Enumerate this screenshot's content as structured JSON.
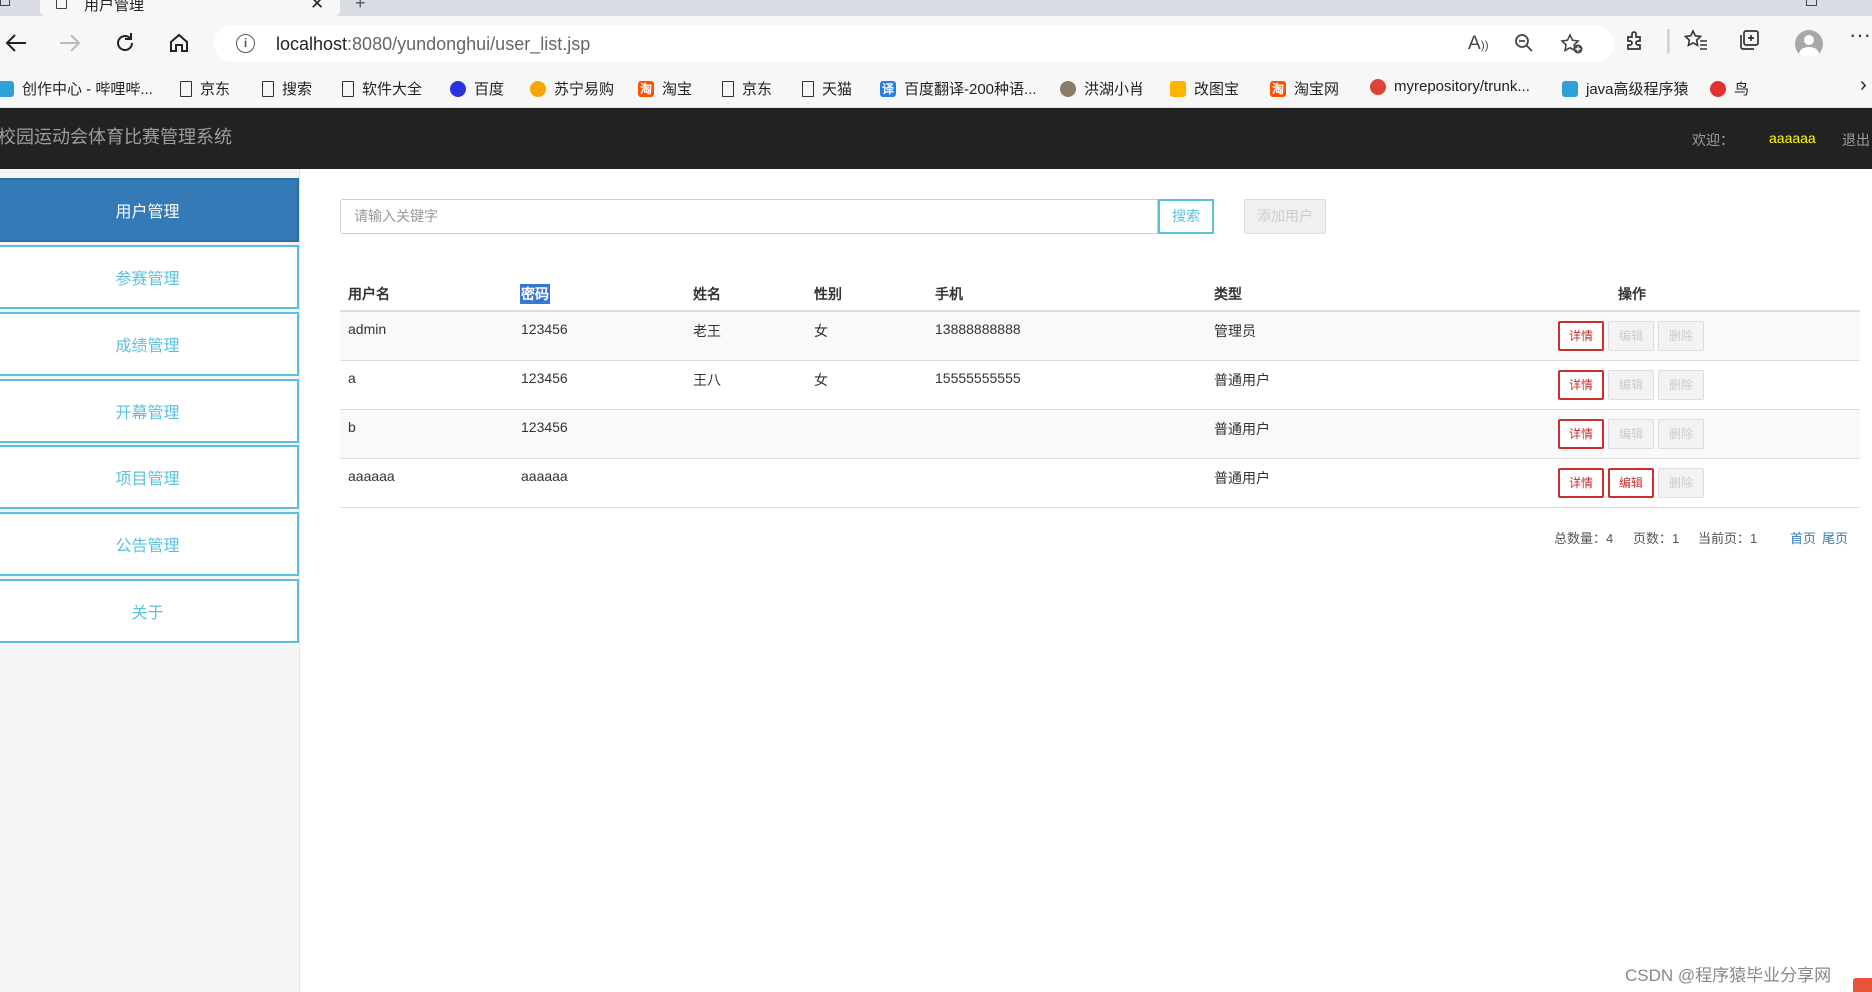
{
  "browser": {
    "tab_title": "用户管理",
    "close_glyph": "✕",
    "new_tab_glyph": "+",
    "address": {
      "host": "localhost",
      "rest": ":8080/yundonghui/user_list.jsp"
    },
    "icons": [
      "back-icon",
      "forward-icon",
      "refresh-icon",
      "home-icon",
      "info-icon",
      "read-aloud-icon",
      "zoom-icon",
      "favorite-add-icon",
      "extensions-icon",
      "favorites-icon",
      "collections-icon",
      "profile-icon",
      "more-icon"
    ],
    "bookmarks": [
      {
        "label": "创作中心 - 哔哩哔...",
        "icon": "bilibili-icon"
      },
      {
        "label": "京东",
        "icon": "page-icon"
      },
      {
        "label": "搜索",
        "icon": "page-icon"
      },
      {
        "label": "软件大全",
        "icon": "page-icon"
      },
      {
        "label": "百度",
        "icon": "baidu-icon"
      },
      {
        "label": "苏宁易购",
        "icon": "suning-icon"
      },
      {
        "label": "淘宝",
        "icon": "taobao-icon"
      },
      {
        "label": "京东",
        "icon": "page-icon"
      },
      {
        "label": "天猫",
        "icon": "page-icon"
      },
      {
        "label": "百度翻译-200种语...",
        "icon": "translate-icon"
      },
      {
        "label": "洪湖小肖",
        "icon": "eagle-icon"
      },
      {
        "label": "改图宝",
        "icon": "gaitubao-icon"
      },
      {
        "label": "淘宝网",
        "icon": "taobao-icon"
      },
      {
        "label": "myrepository/trunk...",
        "icon": "chrome-icon"
      },
      {
        "label": "java高级程序猿",
        "icon": "bilibili-icon"
      },
      {
        "label": "鸟",
        "icon": "bird-icon"
      }
    ],
    "bookmark_glyphs": {
      "taobao": "淘",
      "translate": "译"
    },
    "more_bookmarks_glyph": "›"
  },
  "header": {
    "title": "校园运动会体育比赛管理系统",
    "welcome_label": "欢迎：",
    "username": "aaaaaa",
    "logout_label": "退出"
  },
  "sidebar": {
    "items": [
      {
        "label": "用户管理",
        "active": true
      },
      {
        "label": "参赛管理",
        "active": false
      },
      {
        "label": "成绩管理",
        "active": false
      },
      {
        "label": "开幕管理",
        "active": false
      },
      {
        "label": "项目管理",
        "active": false
      },
      {
        "label": "公告管理",
        "active": false
      },
      {
        "label": "关于",
        "active": false
      }
    ]
  },
  "search": {
    "placeholder": "请输入关键字",
    "search_label": "搜索",
    "add_label": "添加用户"
  },
  "table": {
    "columns": [
      "用户名",
      "密码",
      "姓名",
      "性别",
      "手机",
      "类型",
      "操作"
    ],
    "rows": [
      {
        "username": "admin",
        "password": "123456",
        "name": "老王",
        "gender": "女",
        "phone": "13888888888",
        "type": "管理员",
        "edit_enabled": false
      },
      {
        "username": "a",
        "password": "123456",
        "name": "王八",
        "gender": "女",
        "phone": "15555555555",
        "type": "普通用户",
        "edit_enabled": false
      },
      {
        "username": "b",
        "password": "123456",
        "name": "",
        "gender": "",
        "phone": "",
        "type": "普通用户",
        "edit_enabled": false
      },
      {
        "username": "aaaaaa",
        "password": "aaaaaa",
        "name": "",
        "gender": "",
        "phone": "",
        "type": "普通用户",
        "edit_enabled": true
      }
    ],
    "actions": {
      "detail": "详情",
      "edit": "编辑",
      "delete": "删除"
    }
  },
  "pager": {
    "total_label": "总数量：4",
    "pages_label": "页数：1",
    "current_label": "当前页：1",
    "first_label": "首页",
    "last_label": "尾页"
  },
  "watermark": "CSDN @程序猿毕业分享网",
  "colors": {
    "header_bg": "#222222",
    "active_nav": "#337ab7",
    "nav_border": "#5bc0de",
    "username": "#ffff00",
    "detail_red": "#c9302c"
  }
}
